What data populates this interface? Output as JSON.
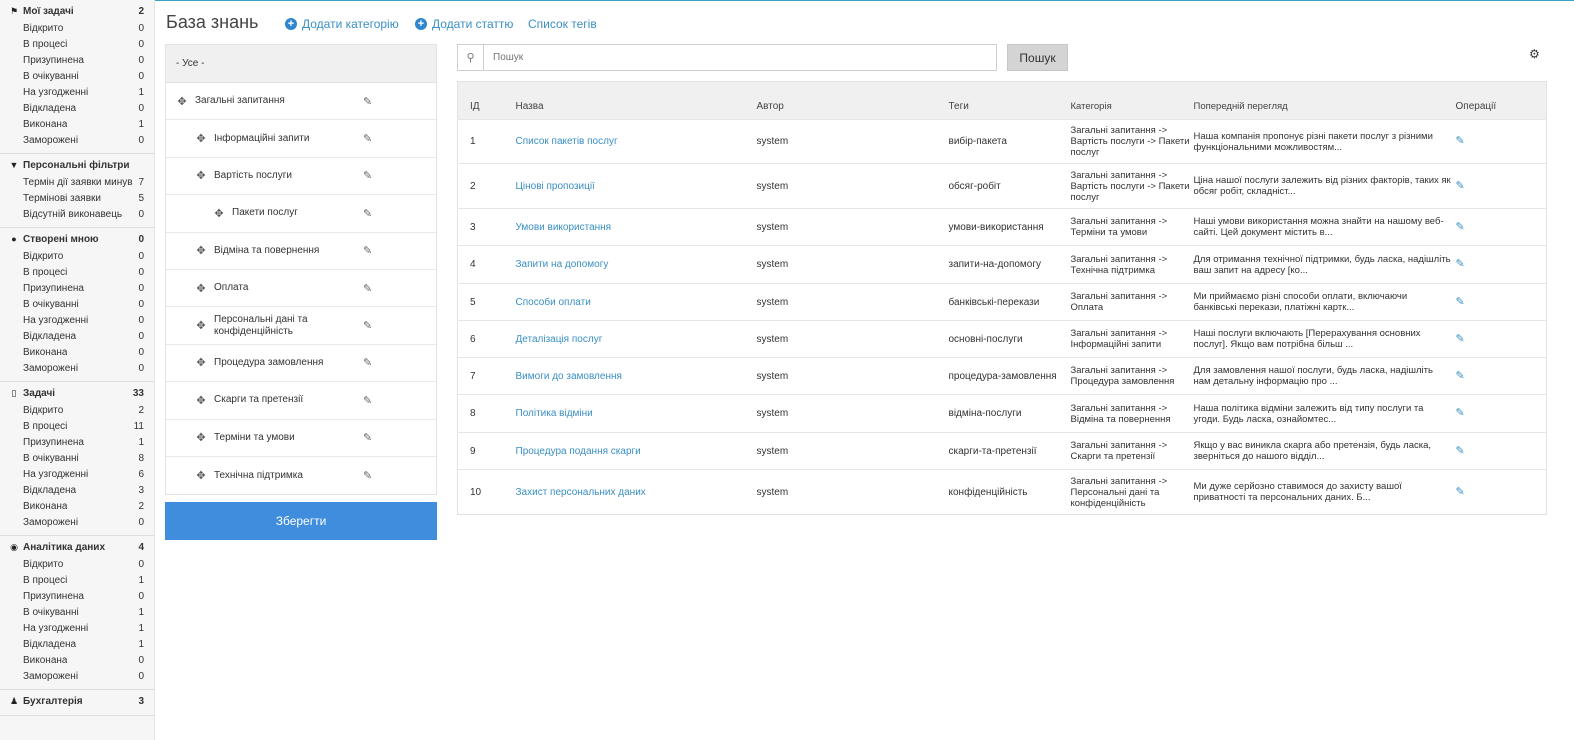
{
  "sidebar": {
    "groups": [
      {
        "icon": "flag-icon",
        "glyph": "⚑",
        "title": "Мої задачі",
        "count": "2",
        "items": [
          {
            "label": "Відкрито",
            "count": "0"
          },
          {
            "label": "В процесі",
            "count": "0"
          },
          {
            "label": "Призупинена",
            "count": "0"
          },
          {
            "label": "В очікуванні",
            "count": "0"
          },
          {
            "label": "На узгодженні",
            "count": "1"
          },
          {
            "label": "Відкладена",
            "count": "0"
          },
          {
            "label": "Виконана",
            "count": "1"
          },
          {
            "label": "Заморожені",
            "count": "0"
          }
        ]
      },
      {
        "icon": "filter-icon",
        "glyph": "▼",
        "title": "Персональні фільтри",
        "count": "",
        "items": [
          {
            "label": "Термін дії заявки минув",
            "count": "7"
          },
          {
            "label": "Термінові заявки",
            "count": "5"
          },
          {
            "label": "Відсутній виконавець",
            "count": "0"
          }
        ]
      },
      {
        "icon": "comment-icon",
        "glyph": "●",
        "title": "Створені мною",
        "count": "0",
        "items": [
          {
            "label": "Відкрито",
            "count": "0"
          },
          {
            "label": "В процесі",
            "count": "0"
          },
          {
            "label": "Призупинена",
            "count": "0"
          },
          {
            "label": "В очікуванні",
            "count": "0"
          },
          {
            "label": "На узгодженні",
            "count": "0"
          },
          {
            "label": "Відкладена",
            "count": "0"
          },
          {
            "label": "Виконана",
            "count": "0"
          },
          {
            "label": "Заморожені",
            "count": "0"
          }
        ]
      },
      {
        "icon": "clipboard-icon",
        "glyph": "▯",
        "title": "Задачі",
        "count": "33",
        "items": [
          {
            "label": "Відкрито",
            "count": "2"
          },
          {
            "label": "В процесі",
            "count": "11"
          },
          {
            "label": "Призупинена",
            "count": "1"
          },
          {
            "label": "В очікуванні",
            "count": "8"
          },
          {
            "label": "На узгодженні",
            "count": "6"
          },
          {
            "label": "Відкладена",
            "count": "3"
          },
          {
            "label": "Виконана",
            "count": "2"
          },
          {
            "label": "Заморожені",
            "count": "0"
          }
        ]
      },
      {
        "icon": "analytics-icon",
        "glyph": "◉",
        "title": "Аналітика даних",
        "count": "4",
        "items": [
          {
            "label": "Відкрито",
            "count": "0"
          },
          {
            "label": "В процесі",
            "count": "1"
          },
          {
            "label": "Призупинена",
            "count": "0"
          },
          {
            "label": "В очікуванні",
            "count": "1"
          },
          {
            "label": "На узгодженні",
            "count": "1"
          },
          {
            "label": "Відкладена",
            "count": "1"
          },
          {
            "label": "Виконана",
            "count": "0"
          },
          {
            "label": "Заморожені",
            "count": "0"
          }
        ]
      },
      {
        "icon": "user-icon",
        "glyph": "♟",
        "title": "Бухгалтерія",
        "count": "3",
        "items": []
      }
    ]
  },
  "header": {
    "title": "База знань",
    "add_category": "Додати категорію",
    "add_article": "Додати статтю",
    "tag_list": "Список тегів"
  },
  "categories": {
    "all_label": "- Усе -",
    "items": [
      {
        "label": "Загальні запитання",
        "level": 0
      },
      {
        "label": "Інформаційні запити",
        "level": 1
      },
      {
        "label": "Вартість послуги",
        "level": 1
      },
      {
        "label": "Пакети послуг",
        "level": 2
      },
      {
        "label": "Відміна та повернення",
        "level": 1
      },
      {
        "label": "Оплата",
        "level": 1
      },
      {
        "label": "Персональні дані та конфіденційність",
        "level": 1
      },
      {
        "label": "Процедура замовлення",
        "level": 1
      },
      {
        "label": "Скарги та претензії",
        "level": 1
      },
      {
        "label": "Терміни та умови",
        "level": 1
      },
      {
        "label": "Технічна підтримка",
        "level": 1
      }
    ],
    "save_label": "Зберегти"
  },
  "search": {
    "placeholder": "Пошук",
    "value": "",
    "button_label": "Пошук"
  },
  "table": {
    "columns": [
      "ІД",
      "Назва",
      "Автор",
      "Теги",
      "Категорія",
      "Попередній перегляд",
      "Операції"
    ],
    "rows": [
      {
        "id": "1",
        "title": "Список пакетів послуг",
        "author": "system",
        "tag": "вибір-пакета",
        "category": "Загальні запитання -> Вартість послуги -> Пакети послуг",
        "preview": "Наша компанія пропонує різні пакети послуг з різними функціональними можливостям...",
        "h": 44
      },
      {
        "id": "2",
        "title": "Цінові пропозиції",
        "author": "system",
        "tag": "обсяг-робіт",
        "category": "Загальні запитання -> Вартість послуги -> Пакети послуг",
        "preview": "Ціна нашої послуги залежить від різних факторів, таких як обсяг робіт, складніст...",
        "h": 45
      },
      {
        "id": "3",
        "title": "Умови використання",
        "author": "system",
        "tag": "умови-використання",
        "category": "Загальні запитання -> Терміни та умови",
        "preview": "Наші умови використання можна знайти на нашому веб-сайті. Цей документ містить в...",
        "h": 37
      },
      {
        "id": "4",
        "title": "Запити на допомогу",
        "author": "system",
        "tag": "запити-на-допомогу",
        "category": "Загальні запитання -> Технічна підтримка",
        "preview": "Для отримання технічної підтримки, будь ласка, надішліть ваш запит на адресу [ко...",
        "h": 38
      },
      {
        "id": "5",
        "title": "Способи оплати",
        "author": "system",
        "tag": "банківські-перекази",
        "category": "Загальні запитання -> Оплата",
        "preview": "Ми приймаємо різні способи оплати, включаючи банківські перекази, платіжні картк...",
        "h": 37
      },
      {
        "id": "6",
        "title": "Деталізація послуг",
        "author": "system",
        "tag": "основні-послуги",
        "category": "Загальні запитання -> Інформаційні запити",
        "preview": "Наші послуги включають [Перерахування основних послуг]. Якщо вам потрібна більш ...",
        "h": 37
      },
      {
        "id": "7",
        "title": "Вимоги до замовлення",
        "author": "system",
        "tag": "процедура-замовлення",
        "category": "Загальні запитання -> Процедура замовлення",
        "preview": "Для замовлення нашої послуги, будь ласка, надішліть нам детальну інформацію про ...",
        "h": 37
      },
      {
        "id": "8",
        "title": "Політика відміни",
        "author": "system",
        "tag": "відміна-послуги",
        "category": "Загальні запитання -> Відміна та повернення",
        "preview": "Наша політика відміни залежить від типу послуги та угоди. Будь ласка, ознайомтес...",
        "h": 38
      },
      {
        "id": "9",
        "title": "Процедура подання скарги",
        "author": "system",
        "tag": "скарги-та-претензії",
        "category": "Загальні запитання -> Скарги та претензії",
        "preview": "Якщо у вас виникла скарга або претензія, будь ласка, зверніться до нашого відділ...",
        "h": 37
      },
      {
        "id": "10",
        "title": "Захист персональних даних",
        "author": "system",
        "tag": "конфіденційність",
        "category": "Загальні запитання -> Персональні дані та конфіденційність",
        "preview": "Ми дуже серйозно ставимося до захисту вашої приватності та персональних даних. Б...",
        "h": 45
      }
    ]
  },
  "colors": {
    "accent": "#3f8ddc",
    "link": "#3a8fc4",
    "sidebar_bg": "#f6f6f6"
  }
}
